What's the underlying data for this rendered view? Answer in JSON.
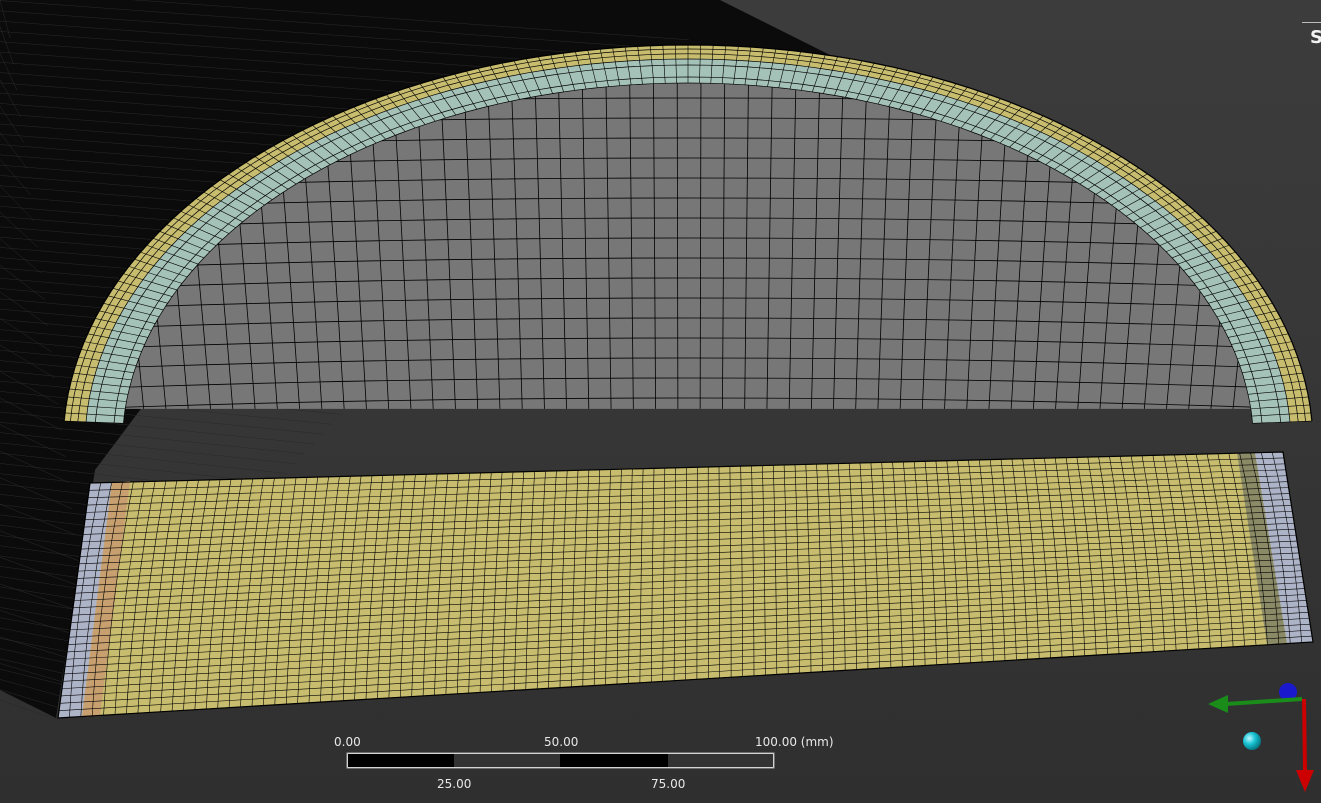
{
  "viewport": {
    "corner_label": "S",
    "colors": {
      "background": "#383838",
      "extrusion": "#0b0b0b",
      "core": "#777777",
      "yellow": "#c8bd6f",
      "light_blue": "#a5c2b9",
      "lavender": "#aeb4c8",
      "orange": "#c8a070",
      "mesh_line": "#000000"
    }
  },
  "scale_bar": {
    "top_labels": [
      "0.00",
      "50.00",
      "100.00 (mm)"
    ],
    "bottom_labels": [
      "25.00",
      "75.00"
    ]
  },
  "triad": {
    "x_color": "#cc0000",
    "y_color": "#1a8c1a",
    "z_color": "#1a1acc",
    "origin_color": "#00b8c8"
  }
}
